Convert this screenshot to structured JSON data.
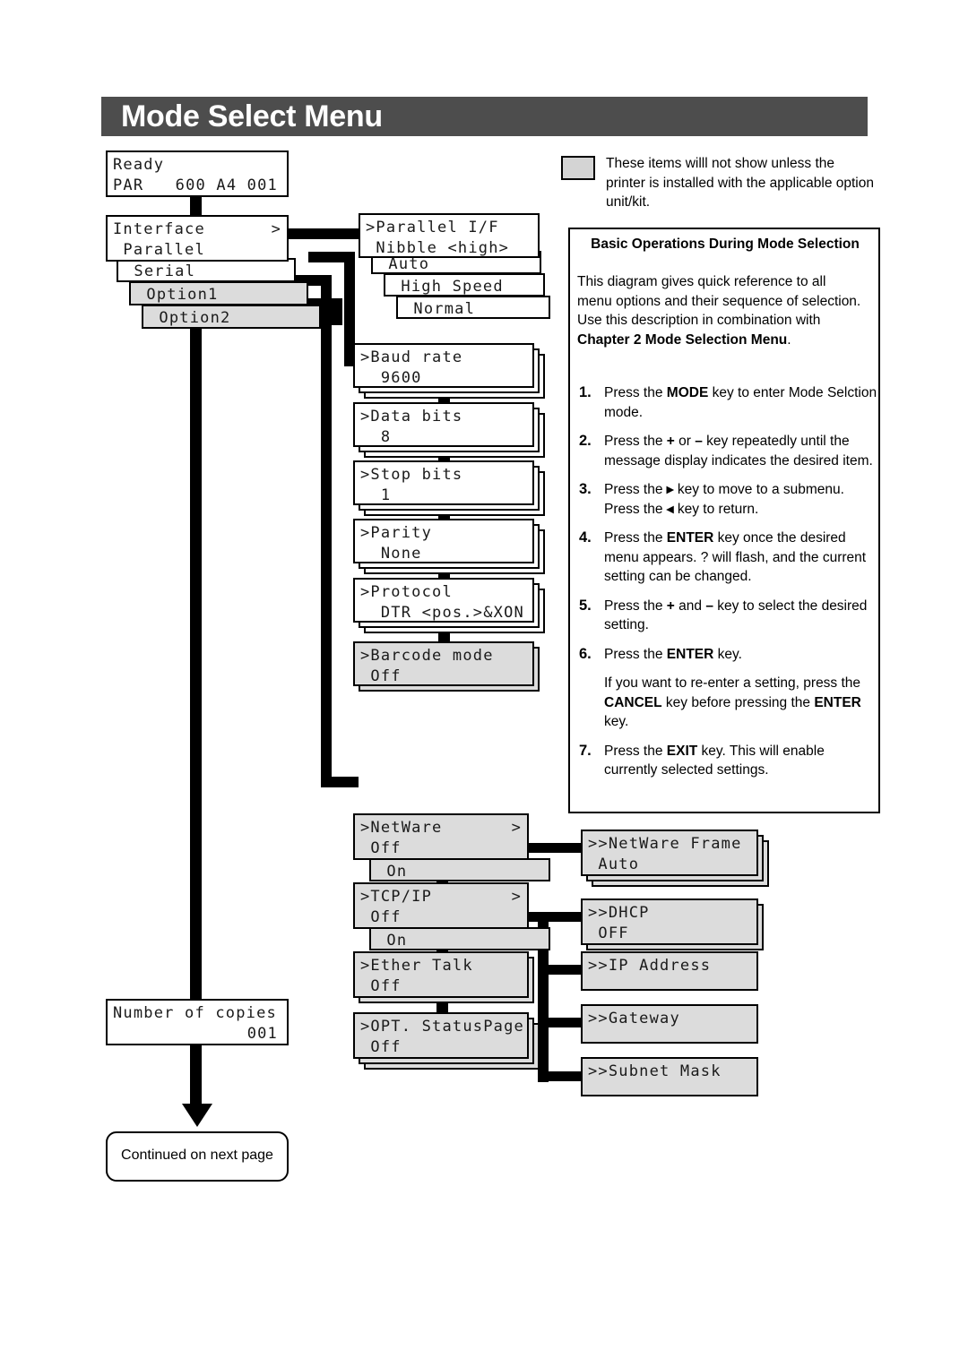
{
  "header": {
    "title": "Mode Select Menu"
  },
  "legend": {
    "swatch_color": "#d4d4d4",
    "text": "These items willl not show unless the printer is installed with the applicable option unit/kit."
  },
  "panel": {
    "heading": "Basic Operations During Mode Selection",
    "intro_a": "This diagram gives quick reference to all menu options and their sequence of selection. Use this description in combination with ",
    "intro_b": "Chapter 2 Mode Selection Menu",
    "intro_c": ".",
    "steps": [
      {
        "n": "1.",
        "parts": [
          "Press the ",
          "MODE",
          " key to enter Mode Selction mode."
        ]
      },
      {
        "n": "2.",
        "parts": [
          "Press the ",
          "+",
          " or ",
          "–",
          " key repeatedly until the message display indicates the desired item."
        ]
      },
      {
        "n": "3.",
        "parts": [
          "Press the ",
          "▸",
          " key to move to a submenu. Press the ",
          "◂",
          " key to return."
        ]
      },
      {
        "n": "4.",
        "parts": [
          "Press the ",
          "ENTER",
          " key once the desired menu appears.  ? will flash, and the current setting can be changed."
        ]
      },
      {
        "n": "5.",
        "parts": [
          "Press the ",
          "+",
          " and ",
          "–",
          " key to select the desired setting."
        ]
      },
      {
        "n": "6.",
        "parts": [
          "Press the ",
          "ENTER",
          " key."
        ]
      },
      {
        "n": "",
        "parts": [
          "If you want to re-enter a setting, press the ",
          "CANCEL",
          " key before pressing the ",
          "ENTER",
          " key."
        ]
      },
      {
        "n": "7.",
        "parts": [
          "Press the ",
          "EXIT",
          " key. This will enable currently selected settings."
        ]
      }
    ]
  },
  "diagram": {
    "status": {
      "line1": "Ready",
      "line2_left": "PAR",
      "line2_right": "600 A4 001"
    },
    "interface": {
      "line1": "Interface",
      "caret": ">",
      "line2": " Parallel",
      "options": [
        {
          "label": " Serial",
          "gray": false
        },
        {
          "label": " Option1",
          "gray": true
        },
        {
          "label": " Option2",
          "gray": true
        }
      ]
    },
    "parallel_if": {
      "line1": ">Parallel I/F",
      "line2": " Nibble <high>",
      "options": [
        {
          "label": " Auto",
          "gray": false
        },
        {
          "label": " High Speed",
          "gray": false
        },
        {
          "label": " Normal",
          "gray": false
        }
      ]
    },
    "serial_items": [
      {
        "line1": ">Baud rate",
        "line2": "  9600",
        "gray": false,
        "plates": 2
      },
      {
        "line1": ">Data bits",
        "line2": "  8",
        "gray": false,
        "plates": 2
      },
      {
        "line1": ">Stop bits",
        "line2": "  1",
        "gray": false,
        "plates": 2
      },
      {
        "line1": ">Parity",
        "line2": "  None",
        "gray": false,
        "plates": 2
      },
      {
        "line1": ">Protocol",
        "line2": "  DTR <pos.>&XON",
        "gray": false,
        "plates": 2
      },
      {
        "line1": ">Barcode mode",
        "line2": " Off",
        "gray": true,
        "plates": 1
      }
    ],
    "network_left": [
      {
        "line1": ">NetWare",
        "line2": " Off",
        "gray": true,
        "caret": ">",
        "sub": " On",
        "plates": 0
      },
      {
        "line1": ">TCP/IP",
        "line2": " Off",
        "gray": true,
        "caret": ">",
        "sub": " On",
        "plates": 0
      },
      {
        "line1": ">Ether Talk",
        "line2": " Off",
        "gray": true,
        "caret": "",
        "sub": "",
        "plates": 1
      },
      {
        "line1": ">OPT. StatusPage",
        "line2": " Off",
        "gray": true,
        "caret": "",
        "sub": "",
        "plates": 2
      }
    ],
    "network_right": [
      {
        "line1": ">>NetWare Frame",
        "line2": " Auto",
        "gray": true,
        "plates": 2
      },
      {
        "line1": ">>DHCP",
        "line2": " OFF",
        "gray": true,
        "plates": 1
      },
      {
        "line1": ">>IP Address",
        "line2": "",
        "gray": true,
        "plates": 0
      },
      {
        "line1": ">>Gateway",
        "line2": "",
        "gray": true,
        "plates": 0
      },
      {
        "line1": ">>Subnet Mask",
        "line2": "",
        "gray": true,
        "plates": 0
      }
    ],
    "copies": {
      "line1": "Number of copies",
      "line2": "001"
    },
    "continued": {
      "label": "Continued on next page"
    }
  }
}
